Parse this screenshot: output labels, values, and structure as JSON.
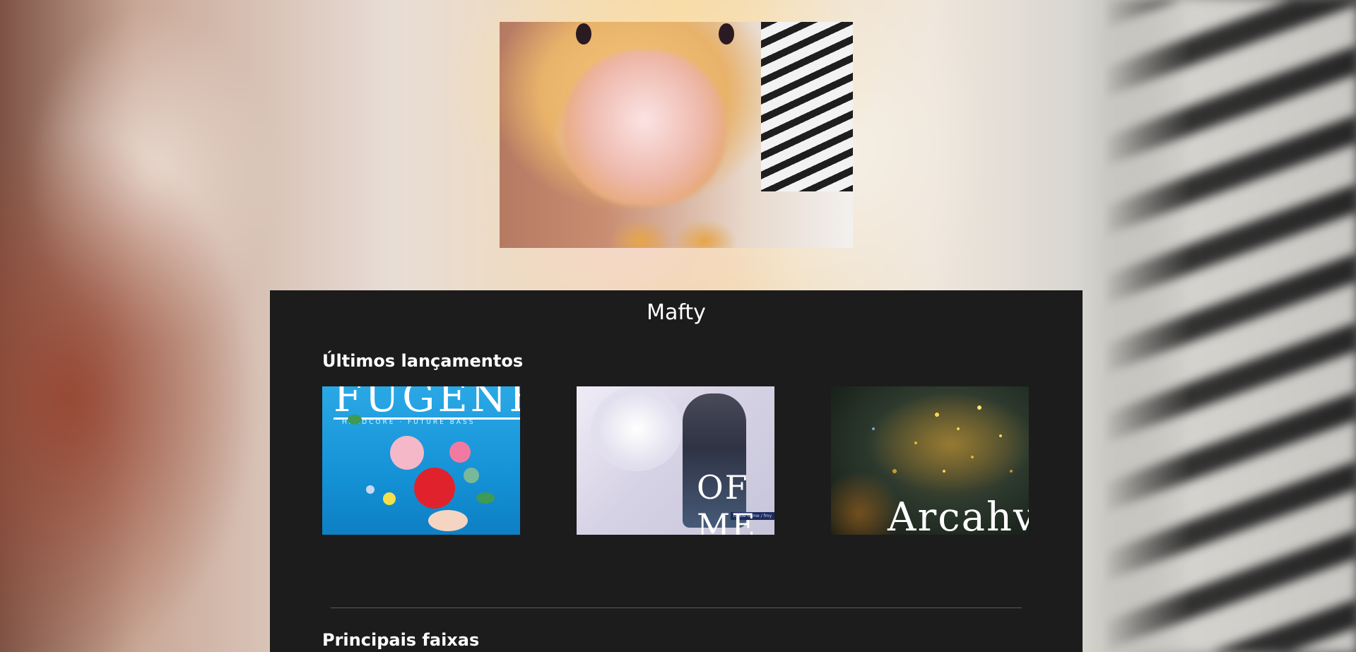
{
  "artist": {
    "name": "Mafty"
  },
  "sections": {
    "latest_releases": "Últimos lançamentos",
    "top_tracks": "Principais faixas"
  },
  "releases": [
    {
      "cover_text": "FUGENE",
      "cover_subtext": "HARDCORE · FUTURE BASS"
    },
    {
      "cover_text": "OF ME",
      "cover_subtext": "Inside of me / fmy"
    },
    {
      "cover_text": "Arcahv"
    }
  ],
  "colors": {
    "panel_bg": "#1c1c1c",
    "text": "#ffffff",
    "divider": "#5a5a5a"
  }
}
